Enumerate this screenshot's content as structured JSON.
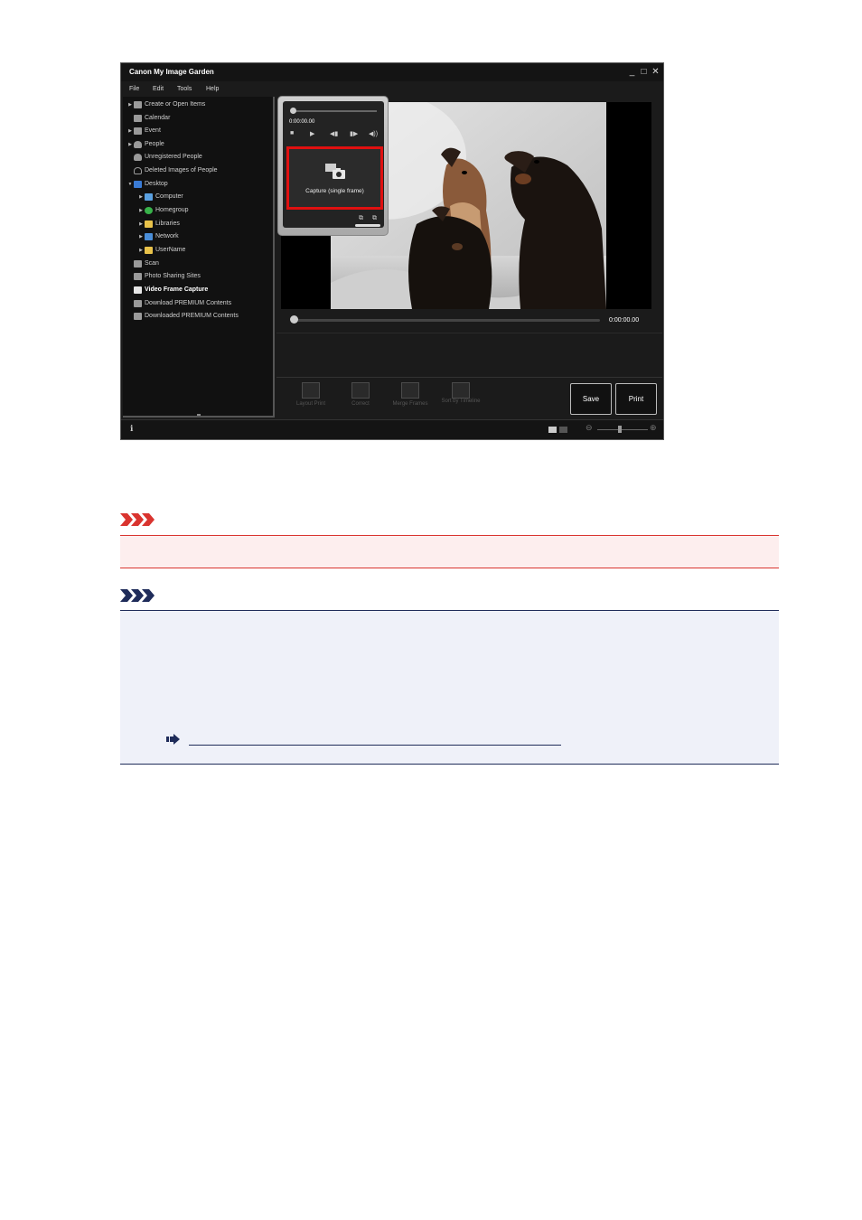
{
  "window": {
    "title": "Canon My Image Garden",
    "controls": [
      "_",
      "□",
      "✕"
    ]
  },
  "menu": [
    "File",
    "Edit",
    "Tools",
    "Help"
  ],
  "sidebar": {
    "items": [
      {
        "label": "Create or Open Items",
        "icon": "create-items-icon",
        "color": "#cfcfcf"
      },
      {
        "label": "Calendar",
        "icon": "calendar-icon",
        "color": "#cfcfcf"
      },
      {
        "label": "Event",
        "icon": "event-icon",
        "color": "#cfcfcf"
      },
      {
        "label": "People",
        "icon": "people-icon",
        "color": "#cfcfcf"
      },
      {
        "label": "Unregistered People",
        "icon": "unregistered-people-icon",
        "color": "#cfcfcf"
      },
      {
        "label": "Deleted Images of People",
        "icon": "deleted-images-icon",
        "color": "#cfcfcf"
      },
      {
        "label": "Desktop",
        "icon": "desktop-icon",
        "color": "#3a7bd5"
      },
      {
        "label": "Computer",
        "icon": "computer-icon",
        "color": "#5aa0e0"
      },
      {
        "label": "Homegroup",
        "icon": "homegroup-icon",
        "color": "#38b24a"
      },
      {
        "label": "Libraries",
        "icon": "libraries-icon",
        "color": "#e8c24a"
      },
      {
        "label": "Network",
        "icon": "network-icon",
        "color": "#4a8ed8"
      },
      {
        "label": "UserName",
        "icon": "user-folder-icon",
        "color": "#e8c24a"
      },
      {
        "label": "Scan",
        "icon": "scan-icon",
        "color": "#cfcfcf"
      },
      {
        "label": "Photo Sharing Sites",
        "icon": "photo-sharing-icon",
        "color": "#cfcfcf"
      },
      {
        "label": "Video Frame Capture",
        "icon": "video-frame-capture-icon",
        "color": "#ffffff",
        "selected": true
      },
      {
        "label": "Download PREMIUM Contents",
        "icon": "download-premium-icon",
        "color": "#cfcfcf"
      },
      {
        "label": "Downloaded PREMIUM Contents",
        "icon": "downloaded-premium-icon",
        "color": "#cfcfcf"
      }
    ]
  },
  "capture_panel": {
    "time": "0:00:00.00",
    "capture_label": "Capture (single frame)"
  },
  "viewer": {
    "time": "0:00:00.00"
  },
  "toolbar": {
    "tools": [
      {
        "label": "Layout Print"
      },
      {
        "label": "Correct"
      },
      {
        "label": "Merge Frames"
      },
      {
        "label": "Sort by Timeline"
      }
    ],
    "save_label": "Save",
    "print_label": "Print"
  },
  "colors": {
    "important": "#d9342f",
    "note": "#1f2c5a",
    "capture_highlight": "#e01010"
  }
}
